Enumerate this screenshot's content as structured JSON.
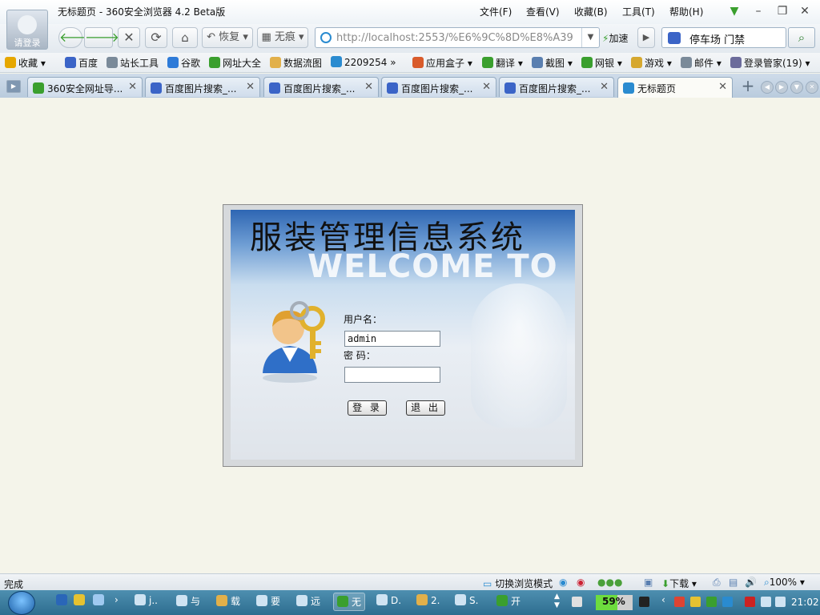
{
  "window": {
    "title": "无标题页 - 360安全浏览器 4.2 Beta版",
    "avatar_label": "请登录",
    "menu": [
      "文件(F)",
      "查看(V)",
      "收藏(B)",
      "工具(T)",
      "帮助(H)"
    ]
  },
  "nav": {
    "restore_label": "恢复",
    "incognito_label": "无痕",
    "address": "http://localhost:2553/%E6%9C%8D%E8%A39",
    "speed_label": "加速",
    "search_value": "停车场 门禁"
  },
  "bookmarks": [
    {
      "label": "收藏",
      "icon": "star-icon",
      "color": "#e6a700"
    },
    {
      "label": "百度",
      "icon": "baidu-icon",
      "color": "#3b64c7"
    },
    {
      "label": "站长工具",
      "icon": "page-icon",
      "color": "#7a8a99"
    },
    {
      "label": "谷歌",
      "icon": "google-icon",
      "color": "#2e7bd8"
    },
    {
      "label": "网址大全",
      "icon": "360-icon",
      "color": "#3a9f2e"
    },
    {
      "label": "数据流图",
      "icon": "folder-icon",
      "color": "#e2b04a"
    },
    {
      "label": "2209254",
      "icon": "ie-icon",
      "color": "#2a8bd0"
    },
    {
      "label": "应用盒子",
      "icon": "box-icon",
      "color": "#d95b2b"
    },
    {
      "label": "翻译",
      "icon": "translate-icon",
      "color": "#3a9f2e"
    },
    {
      "label": "截图",
      "icon": "screenshot-icon",
      "color": "#5a7fb0"
    },
    {
      "label": "网银",
      "icon": "bank-icon",
      "color": "#3a9f2e"
    },
    {
      "label": "游戏",
      "icon": "game-icon",
      "color": "#d6a82f"
    },
    {
      "label": "邮件",
      "icon": "mail-icon",
      "color": "#7a8a99"
    },
    {
      "label": "登录管家(19)",
      "icon": "wrench-icon",
      "color": "#6b6b9b"
    }
  ],
  "tabs": [
    {
      "label": "360安全网址导...",
      "active": false
    },
    {
      "label": "百度图片搜索_...",
      "active": false
    },
    {
      "label": "百度图片搜索_...",
      "active": false
    },
    {
      "label": "百度图片搜索_...",
      "active": false
    },
    {
      "label": "百度图片搜索_...",
      "active": false
    },
    {
      "label": "无标题页",
      "active": true
    }
  ],
  "login": {
    "app_title": "服装管理信息系统",
    "welcome": "WELCOME TO",
    "username_label": "用户名：",
    "username_value": "admin",
    "password_label": "密 码：",
    "password_value": "",
    "login_button": "登 录",
    "exit_button": "退 出"
  },
  "status": {
    "left": "完成",
    "switch_mode": "切换浏览模式",
    "download": "下载",
    "zoom": "100%"
  },
  "taskbar": {
    "tasks": [
      "j..",
      "与",
      "载",
      "要",
      "远",
      "无",
      "D.",
      "2.",
      "S.",
      "开"
    ],
    "active_index": 5,
    "battery_percent": "59%",
    "battery_level": 0.59,
    "clock": "21:02"
  }
}
